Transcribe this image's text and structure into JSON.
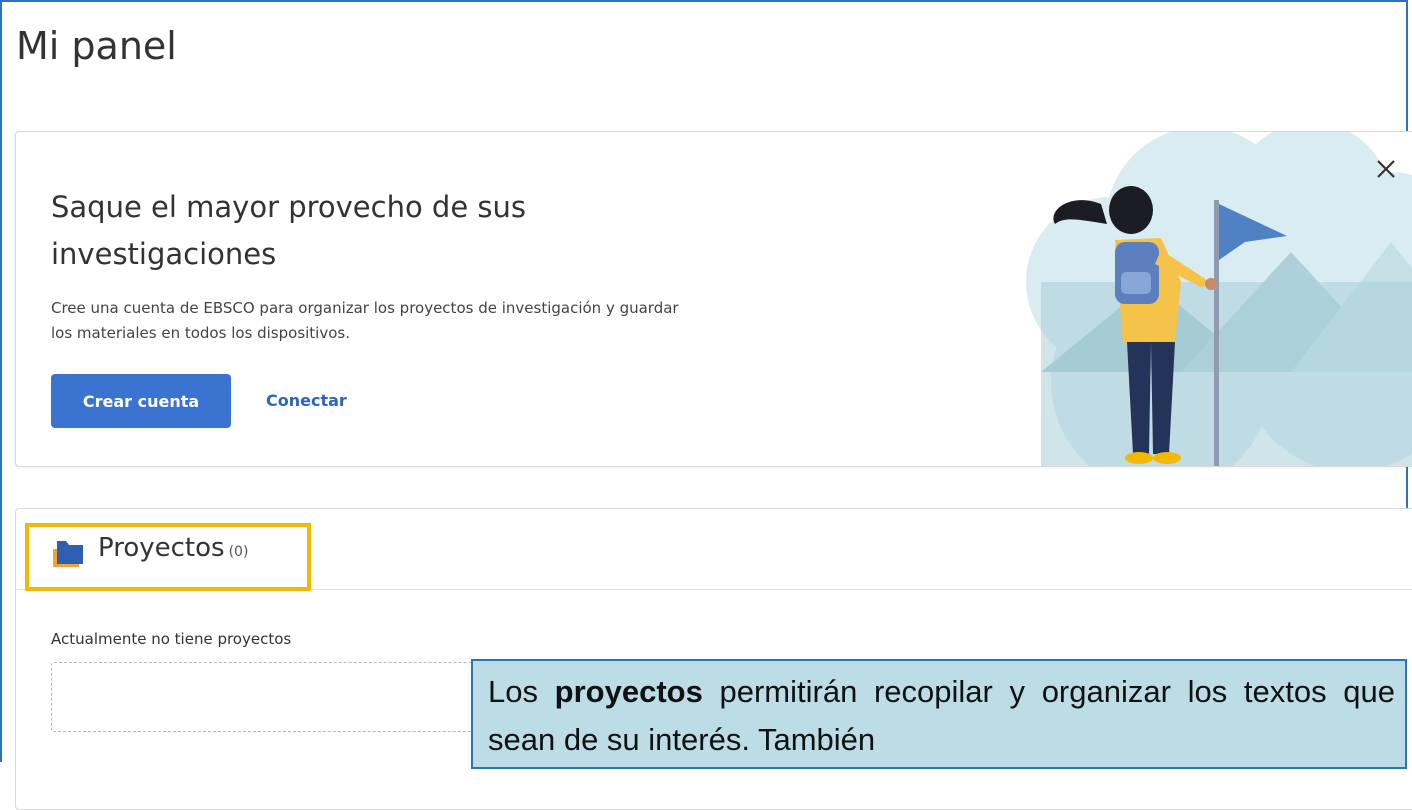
{
  "page": {
    "title": "Mi panel"
  },
  "promo": {
    "title": "Saque el mayor provecho de sus investigaciones",
    "description": "Cree una cuenta de EBSCO para organizar los proyectos de investigación y guardar los materiales en todos los dispositivos.",
    "create_button": "Crear cuenta",
    "login_link": "Conectar",
    "close_icon": "close-icon",
    "illustration": "woman-with-flag-illustration"
  },
  "projects": {
    "icon": "folder-icon",
    "label": "Proyectos",
    "count": "(0)",
    "empty_text": "Actualmente no tiene proyectos"
  },
  "callout": {
    "prefix": "Los ",
    "bold": "proyectos",
    "rest": " permitirán recopilar y organizar los textos que sean de su interés. También"
  },
  "colors": {
    "primary_button": "#3b73d1",
    "link": "#2c64c4",
    "highlight": "#f3b800",
    "frame": "#2e74b5",
    "callout_bg": "#bcdde6"
  }
}
